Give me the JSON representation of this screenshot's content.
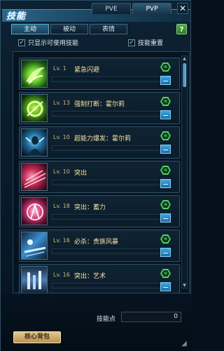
{
  "window": {
    "title": "技能",
    "mode_tabs": [
      {
        "label": "PVE",
        "active": false
      },
      {
        "label": "PVP",
        "active": true
      }
    ],
    "close_label": "✕",
    "help_label": "?"
  },
  "sub_tabs": [
    {
      "label": "主动",
      "active": true
    },
    {
      "label": "被动",
      "active": false
    },
    {
      "label": "表情",
      "active": false
    }
  ],
  "filters": {
    "only_usable": {
      "label": "只显示可使用技能",
      "checked": true
    },
    "skill_reset": {
      "label": "技能重置",
      "checked": true
    }
  },
  "skills": [
    {
      "level": "Lv. 1",
      "name": "紧急闪避",
      "icon": "dodge-skill-icon"
    },
    {
      "level": "Lv. 13",
      "name": "强制打断：霍尔莉",
      "icon": "interrupt-skill-icon"
    },
    {
      "level": "Lv. 10",
      "name": "超能力爆发：霍尔莉",
      "icon": "psychic-burst-skill-icon"
    },
    {
      "level": "Lv. 10",
      "name": "突出",
      "icon": "rush-skill-icon"
    },
    {
      "level": "Lv. 18",
      "name": "突出：蓄力",
      "icon": "charged-rush-skill-icon"
    },
    {
      "level": "Lv. 16",
      "name": "必杀：贵族风暴",
      "icon": "noble-storm-skill-icon"
    },
    {
      "level": "Lv. 16",
      "name": "突出：艺术",
      "icon": "art-rush-skill-icon"
    }
  ],
  "bottom": {
    "points_label": "技能点",
    "points_value": "0",
    "core_bag_label": "核心背包"
  },
  "colors": {
    "accent_green": "#4fd25a",
    "accent_blue": "#3aa8e0",
    "title_bar": "#2a6588",
    "gold_button": "#e3c98e"
  }
}
